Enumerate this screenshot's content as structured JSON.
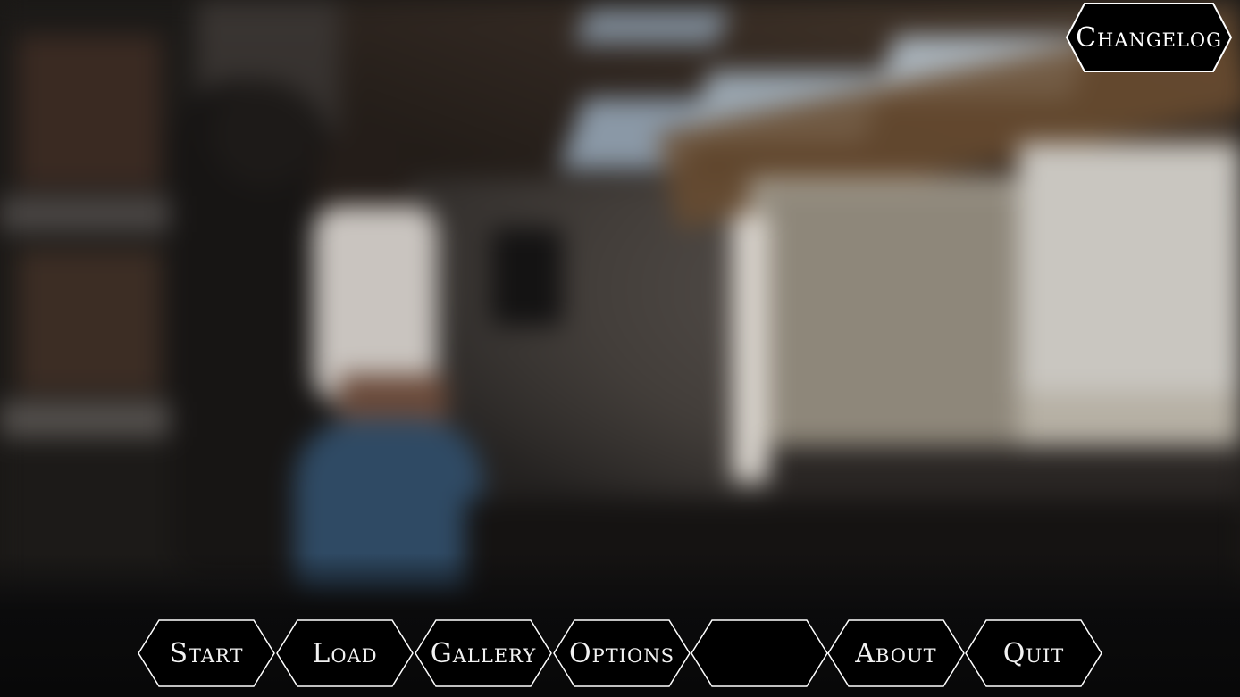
{
  "main_menu": {
    "buttons": [
      {
        "label": "Start"
      },
      {
        "label": "Load"
      },
      {
        "label": "Gallery"
      },
      {
        "label": "Options"
      },
      {
        "label": ""
      },
      {
        "label": "About"
      },
      {
        "label": "Quit"
      }
    ]
  },
  "top_right": {
    "changelog_label": "Changelog"
  },
  "colors": {
    "button_fill": "#000000",
    "button_border": "#ffffff",
    "button_text": "#f2f2f2"
  }
}
